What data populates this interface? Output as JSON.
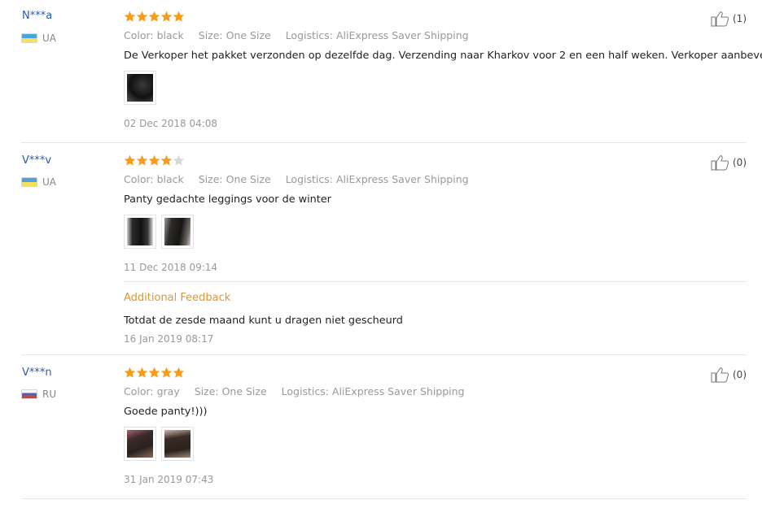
{
  "reviews": [
    {
      "user": "N***a",
      "country": "UA",
      "rating": 5,
      "color_label": "Color: black",
      "size_label": "Size: One Size",
      "logistics_label": "Logistics: AliExpress Saver Shipping",
      "text": "De Verkoper het pakket verzonden op dezelfde dag. Verzending naar Kharkov voor 2 en een half weken. Verkoper aanbevelen.",
      "photos": 1,
      "date": "02 Dec 2018 04:08",
      "helpful": "(1)"
    },
    {
      "user": "V***v",
      "country": "UA",
      "rating": 4,
      "color_label": "Color: black",
      "size_label": "Size: One Size",
      "logistics_label": "Logistics: AliExpress Saver Shipping",
      "text": "Panty gedachte leggings voor de winter",
      "photos": 2,
      "date": "11 Dec 2018 09:14",
      "helpful": "(0)",
      "additional": {
        "label": "Additional Feedback",
        "text": "Totdat de zesde maand kunt u dragen niet gescheurd",
        "date": "16 Jan 2019 08:17"
      }
    },
    {
      "user": "V***n",
      "country": "RU",
      "rating": 5,
      "color_label": "Color: gray",
      "size_label": "Size: One Size",
      "logistics_label": "Logistics: AliExpress Saver Shipping",
      "text": "Goede panty!)))",
      "photos": 2,
      "date": "31 Jan 2019 07:43",
      "helpful": "(0)"
    }
  ],
  "colors": {
    "star_filled": "#f79b1c",
    "star_empty": "#d9d9d9",
    "user_link": "#2a5db0",
    "additional_label": "#e2962c"
  },
  "icons": {
    "rating": "star-icon",
    "helpful": "thumbs-up-icon",
    "flag": "flag-icon"
  }
}
